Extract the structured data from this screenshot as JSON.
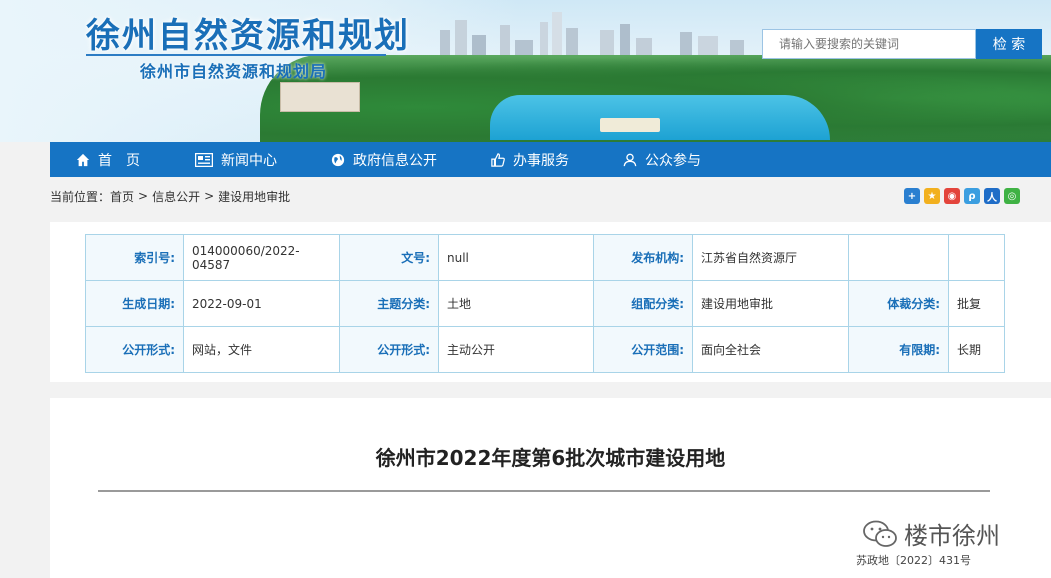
{
  "header": {
    "title": "徐州自然资源和规划",
    "subtitle": "徐州市自然资源和规划局",
    "search_placeholder": "请输入要搜索的关键词",
    "search_button": "检 索"
  },
  "nav": {
    "items": [
      {
        "label": "首　页",
        "icon": "home-icon"
      },
      {
        "label": "新闻中心",
        "icon": "news-icon"
      },
      {
        "label": "政府信息公开",
        "icon": "globe-icon"
      },
      {
        "label": "办事服务",
        "icon": "thumb-up-icon"
      },
      {
        "label": "公众参与",
        "icon": "user-icon"
      }
    ]
  },
  "breadcrumb": {
    "prefix": "当前位置：",
    "items": [
      "首页",
      "信息公开",
      "建设用地审批"
    ],
    "separator": ">"
  },
  "share_icons": [
    "plus-share-icon",
    "qzone-icon",
    "weibo-icon",
    "tencent-weibo-icon",
    "renren-icon",
    "wechat-icon"
  ],
  "meta": {
    "rows": [
      [
        {
          "label": "索引号:",
          "value": "014000060/2022-04587"
        },
        {
          "label": "文号:",
          "value": "null"
        },
        {
          "label": "发布机构:",
          "value": "江苏省自然资源厅"
        },
        {
          "label": "",
          "value": ""
        }
      ],
      [
        {
          "label": "生成日期:",
          "value": "2022-09-01"
        },
        {
          "label": "主题分类:",
          "value": "土地"
        },
        {
          "label": "组配分类:",
          "value": "建设用地审批"
        },
        {
          "label": "体裁分类:",
          "value": "批复"
        }
      ],
      [
        {
          "label": "公开形式:",
          "value": "网站，文件"
        },
        {
          "label": "公开形式:",
          "value": "主动公开"
        },
        {
          "label": "公开范围:",
          "value": "面向全社会"
        },
        {
          "label": "有限期:",
          "value": "长期"
        }
      ]
    ]
  },
  "article": {
    "title": "徐州市2022年度第6批次城市建设用地",
    "watermark": "楼市徐州",
    "doc_number": "苏政地〔2022〕431号"
  },
  "colors": {
    "nav_blue": "#1674c4",
    "label_blue": "#1a6fb8",
    "table_border": "#a9d4e8"
  }
}
